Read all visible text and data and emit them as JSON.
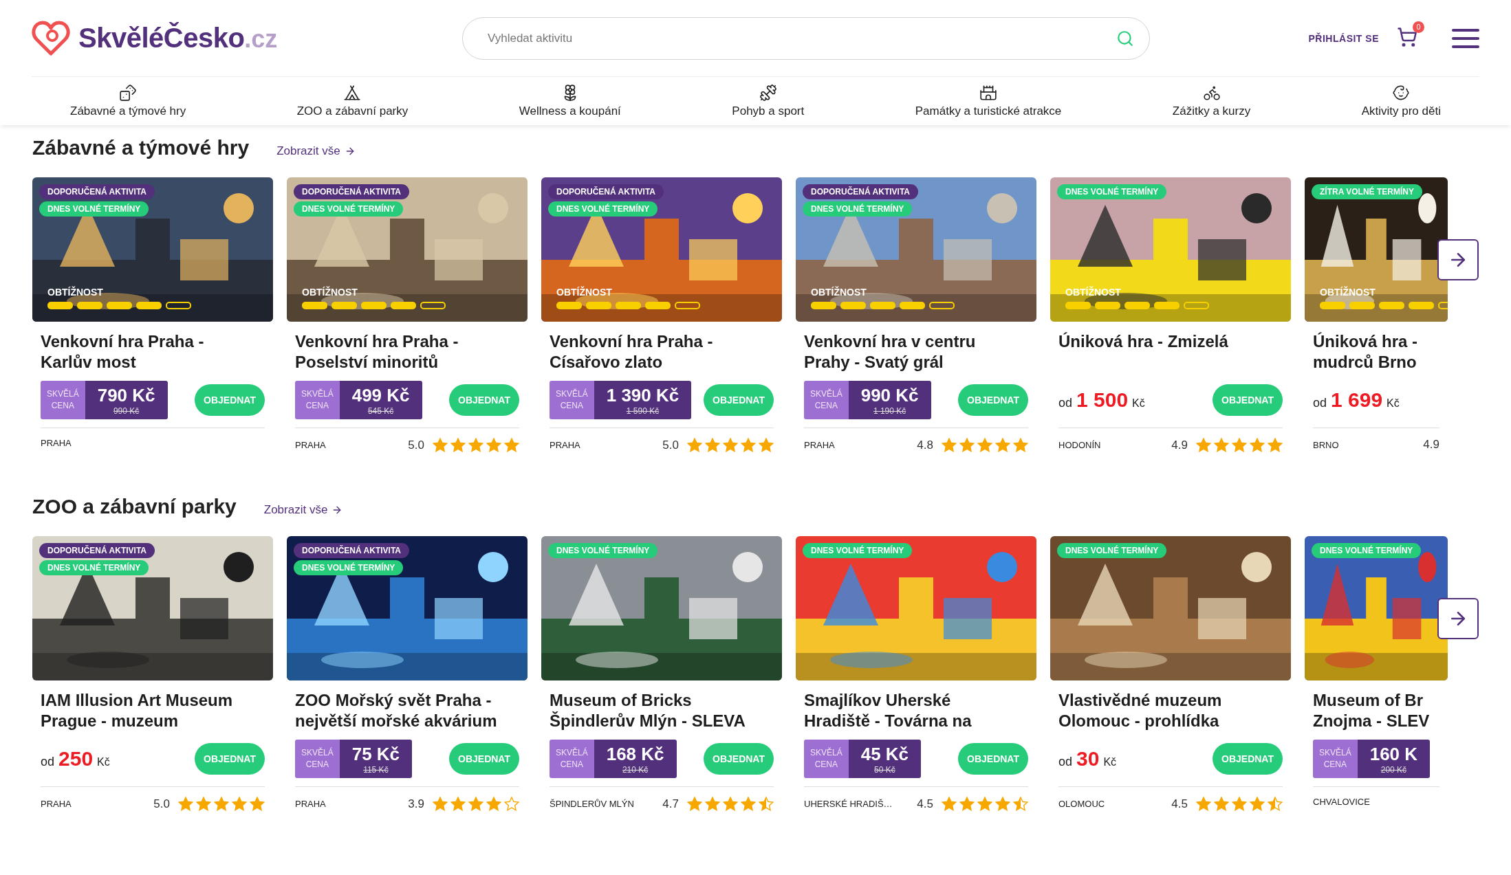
{
  "header": {
    "logo": {
      "name": "SkvěléČesko",
      "tld": ".cz"
    },
    "search": {
      "placeholder": "Vyhledat aktivitu"
    },
    "login": "PŘIHLÁSIT SE",
    "cart_count": "0"
  },
  "nav": [
    "Zábavné a týmové hry",
    "ZOO a zábavní parky",
    "Wellness a koupání",
    "Pohyb a sport",
    "Památky a turistické atrakce",
    "Zážitky a kurzy",
    "Aktivity pro děti"
  ],
  "sections": [
    {
      "title": "Zábavné a týmové hry",
      "link": "Zobrazit vše",
      "cards": [
        {
          "badges": [
            {
              "kind": "recommended",
              "label": "DOPORUČENÁ AKTIVITA"
            },
            {
              "kind": "available",
              "label": "DNES VOLNÉ TERMÍNY"
            }
          ],
          "difficulty": {
            "label": "OBTÍŽNOST",
            "segments": [
              {
                "filled": true
              },
              {
                "filled": true
              },
              {
                "filled": true
              },
              {
                "filled": true
              },
              {
                "filled": false
              }
            ]
          },
          "title": "Venkovní hra Praha -\nKarlův most",
          "price": {
            "kind": "deal",
            "tag": "SKVĚLÁ\nCENA",
            "amount": "790 Kč",
            "old": "990 Kč"
          },
          "button": "OBJEDNAT",
          "location": "PRAHA"
        },
        {
          "badges": [
            {
              "kind": "recommended",
              "label": "DOPORUČENÁ AKTIVITA"
            },
            {
              "kind": "available",
              "label": "DNES VOLNÉ TERMÍNY"
            }
          ],
          "difficulty": {
            "label": "OBTÍŽNOST",
            "segments": [
              {
                "filled": true
              },
              {
                "filled": true
              },
              {
                "filled": true
              },
              {
                "filled": true
              },
              {
                "filled": false
              }
            ]
          },
          "title": "Venkovní hra Praha -\nPoselství minoritů",
          "price": {
            "kind": "deal",
            "tag": "SKVĚLÁ\nCENA",
            "amount": "499 Kč",
            "old": "545 Kč"
          },
          "button": "OBJEDNAT",
          "location": "PRAHA",
          "rating": "5.0",
          "stars": 5
        },
        {
          "badges": [
            {
              "kind": "recommended",
              "label": "DOPORUČENÁ AKTIVITA"
            },
            {
              "kind": "available",
              "label": "DNES VOLNÉ TERMÍNY"
            }
          ],
          "difficulty": {
            "label": "OBTÍŽNOST",
            "segments": [
              {
                "filled": true
              },
              {
                "filled": true
              },
              {
                "filled": true
              },
              {
                "filled": true
              },
              {
                "filled": false
              }
            ]
          },
          "title": "Venkovní hra Praha -\nCísařovo zlato",
          "price": {
            "kind": "deal",
            "tag": "SKVĚLÁ\nCENA",
            "amount": "1 390 Kč",
            "old": "1 590 Kč"
          },
          "button": "OBJEDNAT",
          "location": "PRAHA",
          "rating": "5.0",
          "stars": 5
        },
        {
          "badges": [
            {
              "kind": "recommended",
              "label": "DOPORUČENÁ AKTIVITA"
            },
            {
              "kind": "available",
              "label": "DNES VOLNÉ TERMÍNY"
            }
          ],
          "difficulty": {
            "label": "OBTÍŽNOST",
            "segments": [
              {
                "filled": true
              },
              {
                "filled": true
              },
              {
                "filled": true
              },
              {
                "filled": true
              },
              {
                "filled": false
              }
            ]
          },
          "title": "Venkovní hra v centru\nPrahy - Svatý grál",
          "price": {
            "kind": "deal",
            "tag": "SKVĚLÁ\nCENA",
            "amount": "990 Kč",
            "old": "1 190 Kč"
          },
          "button": "OBJEDNAT",
          "location": "PRAHA",
          "rating": "4.8",
          "stars": 5
        },
        {
          "badges": [
            {
              "kind": "available",
              "label": "DNES VOLNÉ TERMÍNY"
            }
          ],
          "difficulty": {
            "label": "OBTÍŽNOST",
            "segments": [
              {
                "filled": true
              },
              {
                "filled": true
              },
              {
                "filled": true
              },
              {
                "filled": true
              },
              {
                "filled": false
              }
            ]
          },
          "title": "Úniková hra - Zmizelá",
          "price": {
            "kind": "from",
            "prefix": "od",
            "amount": "1 500",
            "currency": "Kč"
          },
          "button": "OBJEDNAT",
          "location": "HODONÍN",
          "rating": "4.9",
          "stars": 5
        },
        {
          "badges": [
            {
              "kind": "available",
              "label": "ZÍTRA VOLNÉ TERMÍNY"
            }
          ],
          "difficulty": {
            "label": "OBTÍŽNOST",
            "segments": [
              {
                "filled": true
              },
              {
                "filled": true
              },
              {
                "filled": true
              },
              {
                "filled": true
              },
              {
                "filled": false
              }
            ]
          },
          "title": "Úniková hra -\nmudrců Brno",
          "price": {
            "kind": "from",
            "prefix": "od",
            "amount": "1 699",
            "currency": "Kč"
          },
          "location": "BRNO",
          "rating": "4.9"
        }
      ]
    },
    {
      "title": "ZOO a zábavní parky",
      "link": "Zobrazit vše",
      "cards": [
        {
          "badges": [
            {
              "kind": "recommended",
              "label": "DOPORUČENÁ AKTIVITA"
            },
            {
              "kind": "available",
              "label": "DNES VOLNÉ TERMÍNY"
            }
          ],
          "title": "IAM Illusion Art Museum\nPrague - muzeum",
          "price": {
            "kind": "from",
            "prefix": "od",
            "amount": "250",
            "currency": "Kč"
          },
          "button": "OBJEDNAT",
          "location": "PRAHA",
          "rating": "5.0",
          "stars": 5
        },
        {
          "badges": [
            {
              "kind": "recommended",
              "label": "DOPORUČENÁ AKTIVITA"
            },
            {
              "kind": "available",
              "label": "DNES VOLNÉ TERMÍNY"
            }
          ],
          "title": "ZOO Mořský svět Praha -\nnejvětší mořské akvárium",
          "price": {
            "kind": "deal",
            "tag": "SKVĚLÁ\nCENA",
            "amount": "75 Kč",
            "old": "115 Kč"
          },
          "button": "OBJEDNAT",
          "location": "PRAHA",
          "rating": "3.9",
          "stars": 4
        },
        {
          "badges": [
            {
              "kind": "available",
              "label": "DNES VOLNÉ TERMÍNY"
            }
          ],
          "title": "Museum of Bricks\nŠpindlerův Mlýn - SLEVA",
          "price": {
            "kind": "deal",
            "tag": "SKVĚLÁ\nCENA",
            "amount": "168 Kč",
            "old": "210 Kč"
          },
          "button": "OBJEDNAT",
          "location": "ŠPINDLERŮV MLÝN",
          "rating": "4.7",
          "stars": 4.5
        },
        {
          "badges": [
            {
              "kind": "available",
              "label": "DNES VOLNÉ TERMÍNY"
            }
          ],
          "title": "Smajlíkov Uherské\nHradiště - Továrna na",
          "price": {
            "kind": "deal",
            "tag": "SKVĚLÁ\nCENA",
            "amount": "45 Kč",
            "old": "50 Kč"
          },
          "button": "OBJEDNAT",
          "location": "UHERSKÉ HRADIŠ…",
          "rating": "4.5",
          "stars": 4.5
        },
        {
          "badges": [
            {
              "kind": "available",
              "label": "DNES VOLNÉ TERMÍNY"
            }
          ],
          "title": "Vlastivědné muzeum\nOlomouc - prohlídka",
          "price": {
            "kind": "from",
            "prefix": "od",
            "amount": "30",
            "currency": "Kč"
          },
          "button": "OBJEDNAT",
          "location": "OLOMOUC",
          "rating": "4.5",
          "stars": 4.5
        },
        {
          "badges": [
            {
              "kind": "available",
              "label": "DNES VOLNÉ TERMÍNY"
            }
          ],
          "title": "Museum of Br\nZnojma - SLEV",
          "price": {
            "kind": "deal",
            "tag": "SKVĚLÁ\nCENA",
            "amount": "160 K",
            "old": "200 Kč"
          },
          "location": "CHVALOVICE"
        }
      ]
    }
  ]
}
